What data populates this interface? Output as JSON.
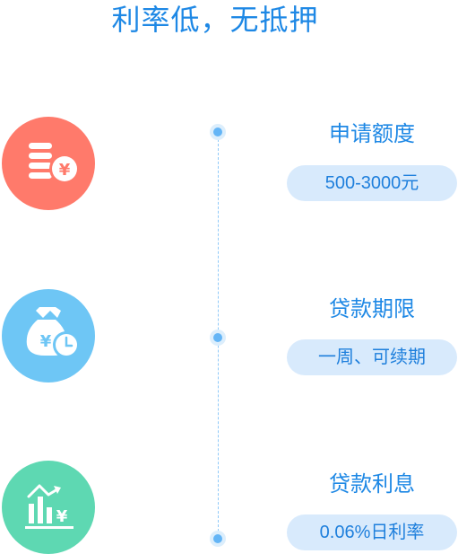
{
  "headline": "利率低，无抵押",
  "colors": {
    "accent": "#1e88e5",
    "pill_bg": "#d8eafc",
    "timeline_dot": "#64b5f6",
    "icon_coins_bg": "#ff7a6b",
    "icon_moneybag_bg": "#6ec6f5",
    "icon_chart_bg": "#5ed8b2"
  },
  "items": [
    {
      "icon": "coins-yen-icon",
      "title": "申请额度",
      "value": "500-3000元"
    },
    {
      "icon": "money-bag-clock-icon",
      "title": "贷款期限",
      "value": "一周、可续期"
    },
    {
      "icon": "chart-down-yen-icon",
      "title": "贷款利息",
      "value": "0.06%日利率"
    }
  ]
}
